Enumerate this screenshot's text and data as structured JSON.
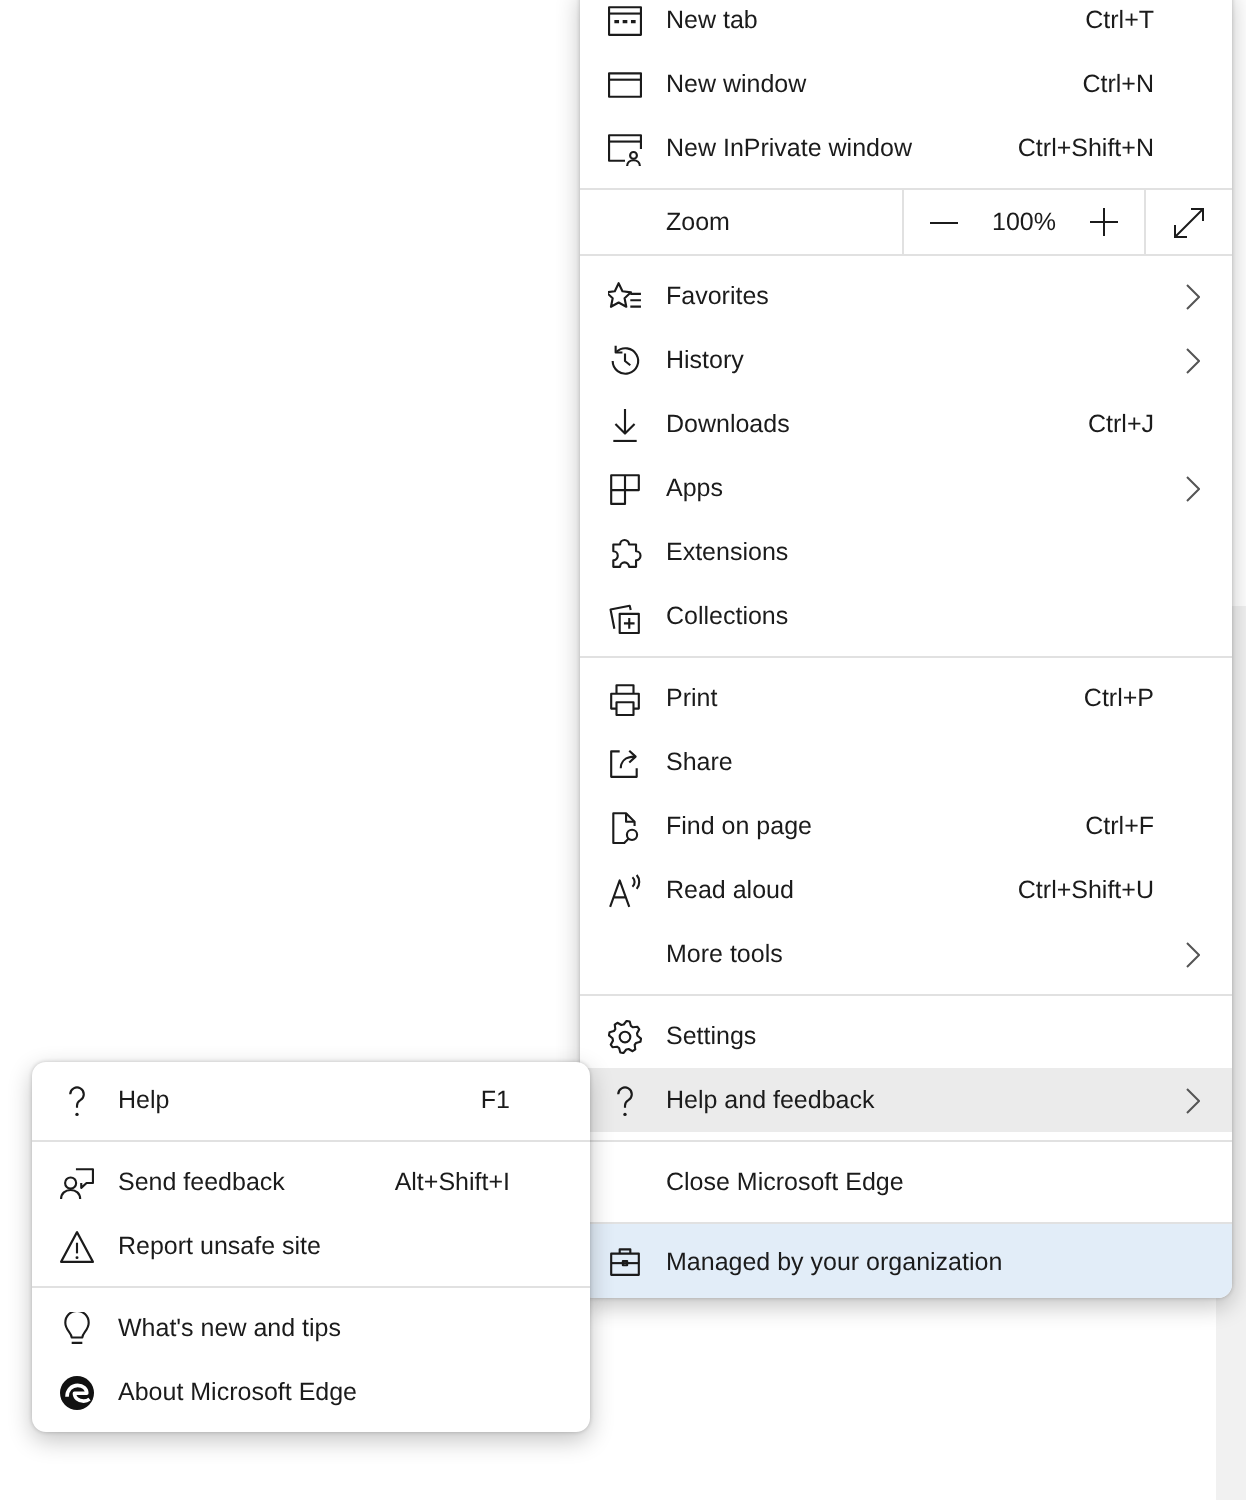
{
  "main_menu": {
    "items": [
      {
        "kind": "command",
        "label": "New tab",
        "shortcut": "Ctrl+T",
        "submenu": false,
        "highlighted": false
      },
      {
        "kind": "command",
        "label": "New window",
        "shortcut": "Ctrl+N",
        "submenu": false,
        "highlighted": false
      },
      {
        "kind": "command",
        "label": "New InPrivate window",
        "shortcut": "Ctrl+Shift+N",
        "submenu": false,
        "highlighted": false
      },
      {
        "kind": "separator"
      },
      {
        "kind": "zoom",
        "label": "Zoom",
        "value": "100%"
      },
      {
        "kind": "separator"
      },
      {
        "kind": "command",
        "label": "Favorites",
        "submenu": true,
        "highlighted": false
      },
      {
        "kind": "command",
        "label": "History",
        "submenu": true,
        "highlighted": false
      },
      {
        "kind": "command",
        "label": "Downloads",
        "shortcut": "Ctrl+J",
        "submenu": false,
        "highlighted": false
      },
      {
        "kind": "command",
        "label": "Apps",
        "submenu": true,
        "highlighted": false
      },
      {
        "kind": "command",
        "label": "Extensions",
        "submenu": false,
        "highlighted": false
      },
      {
        "kind": "command",
        "label": "Collections",
        "submenu": false,
        "highlighted": false
      },
      {
        "kind": "separator"
      },
      {
        "kind": "command",
        "label": "Print",
        "shortcut": "Ctrl+P",
        "submenu": false,
        "highlighted": false
      },
      {
        "kind": "command",
        "label": "Share",
        "submenu": false,
        "highlighted": false
      },
      {
        "kind": "command",
        "label": "Find on page",
        "shortcut": "Ctrl+F",
        "submenu": false,
        "highlighted": false
      },
      {
        "kind": "command",
        "label": "Read aloud",
        "shortcut": "Ctrl+Shift+U",
        "submenu": false,
        "highlighted": false
      },
      {
        "kind": "command",
        "label": "More tools",
        "submenu": true,
        "highlighted": false
      },
      {
        "kind": "separator"
      },
      {
        "kind": "command",
        "label": "Settings",
        "submenu": false,
        "highlighted": false
      },
      {
        "kind": "command",
        "label": "Help and feedback",
        "submenu": true,
        "highlighted": true
      },
      {
        "kind": "separator"
      },
      {
        "kind": "command",
        "label": "Close Microsoft Edge",
        "submenu": false,
        "highlighted": false
      },
      {
        "kind": "separator"
      },
      {
        "kind": "notice",
        "label": "Managed by your organization"
      }
    ]
  },
  "help_submenu": {
    "items": [
      {
        "kind": "command",
        "label": "Help",
        "shortcut": "F1",
        "highlighted": false
      },
      {
        "kind": "separator"
      },
      {
        "kind": "command",
        "label": "Send feedback",
        "shortcut": "Alt+Shift+I",
        "highlighted": false
      },
      {
        "kind": "command",
        "label": "Report unsafe site",
        "highlighted": false
      },
      {
        "kind": "separator"
      },
      {
        "kind": "command",
        "label": "What's new and tips",
        "highlighted": false
      },
      {
        "kind": "command",
        "label": "About Microsoft Edge",
        "highlighted": false
      }
    ]
  }
}
